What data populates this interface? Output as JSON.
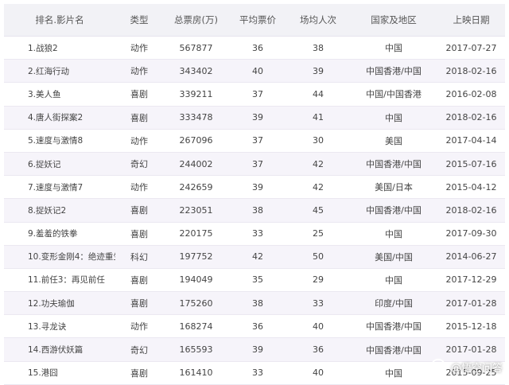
{
  "table": {
    "headers": [
      "排名.影片名",
      "类型",
      "总票房(万)",
      "平均票价",
      "场均人次",
      "国家及地区",
      "上映日期"
    ],
    "rows": [
      [
        "1.战狼2",
        "动作",
        "567877",
        "36",
        "38",
        "中国",
        "2017-07-27"
      ],
      [
        "2.红海行动",
        "动作",
        "343402",
        "40",
        "39",
        "中国香港/中国",
        "2018-02-16"
      ],
      [
        "3.美人鱼",
        "喜剧",
        "339211",
        "37",
        "44",
        "中国/中国香港",
        "2016-02-08"
      ],
      [
        "4.唐人街探案2",
        "喜剧",
        "333478",
        "39",
        "41",
        "中国",
        "2018-02-16"
      ],
      [
        "5.速度与激情8",
        "动作",
        "267096",
        "37",
        "30",
        "美国",
        "2017-04-14"
      ],
      [
        "6.捉妖记",
        "奇幻",
        "244002",
        "37",
        "42",
        "中国香港/中国",
        "2015-07-16"
      ],
      [
        "7.速度与激情7",
        "动作",
        "242659",
        "39",
        "42",
        "美国/日本",
        "2015-04-12"
      ],
      [
        "8.捉妖记2",
        "喜剧",
        "223051",
        "38",
        "45",
        "中国香港/中国",
        "2018-02-16"
      ],
      [
        "9.羞羞的铁拳",
        "喜剧",
        "220175",
        "33",
        "25",
        "中国",
        "2017-09-30"
      ],
      [
        "10.变形金刚4：绝迹重生",
        "科幻",
        "197752",
        "42",
        "50",
        "美国/中国",
        "2014-06-27"
      ],
      [
        "11.前任3：再见前任",
        "喜剧",
        "194049",
        "35",
        "29",
        "中国",
        "2017-12-29"
      ],
      [
        "12.功夫瑜伽",
        "喜剧",
        "175260",
        "38",
        "33",
        "印度/中国",
        "2017-01-28"
      ],
      [
        "13.寻龙诀",
        "动作",
        "168274",
        "36",
        "40",
        "中国香港/中国",
        "2015-12-18"
      ],
      [
        "14.西游伏妖篇",
        "奇幻",
        "165593",
        "39",
        "36",
        "中国香港/中国",
        "2017-01-28"
      ],
      [
        "15.港囧",
        "喜剧",
        "161410",
        "33",
        "40",
        "中国",
        "2015-09-25"
      ]
    ]
  },
  "watermark": {
    "icon": "speech-bubble-logo-icon",
    "text": "@悟空问答"
  }
}
